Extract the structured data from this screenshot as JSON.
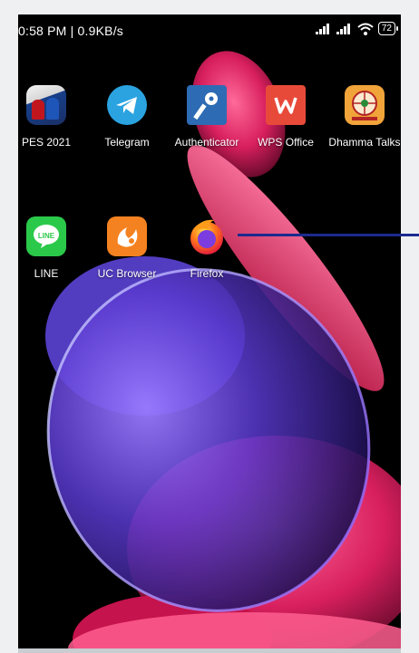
{
  "status_bar": {
    "time_speed": "0:58 PM | 0.9KB/s",
    "battery": "72"
  },
  "apps": [
    {
      "label": "PES 2021",
      "icon": "pes-2021-icon"
    },
    {
      "label": "Telegram",
      "icon": "telegram-icon"
    },
    {
      "label": "Authenticator",
      "icon": "authenticator-key-icon"
    },
    {
      "label": "WPS Office",
      "icon": "wps-office-icon"
    },
    {
      "label": "Dhamma Talks",
      "icon": "dhamma-talks-icon"
    },
    {
      "label": "LINE",
      "icon": "line-icon"
    },
    {
      "label": "UC Browser",
      "icon": "uc-browser-icon"
    },
    {
      "label": "Firefox",
      "icon": "firefox-icon"
    }
  ],
  "colors": {
    "wallpaper_pink": "#e8336d",
    "wallpaper_blue": "#6c49d8",
    "pointer_line": "#1c2a8f"
  }
}
